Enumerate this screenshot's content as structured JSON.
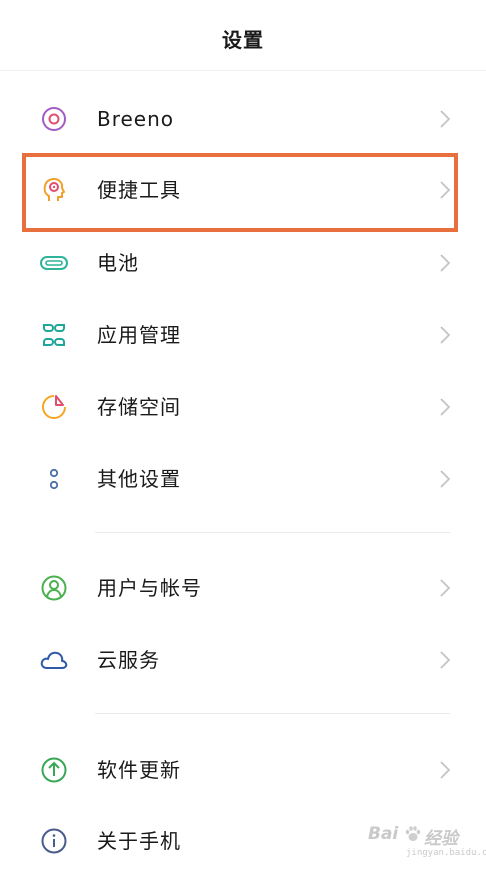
{
  "header": {
    "title": "设置"
  },
  "settings": {
    "items": [
      {
        "label": "Breeno",
        "icon": "breeno-icon",
        "color": "#a35bc4"
      },
      {
        "label": "便捷工具",
        "icon": "convenience-tools-icon",
        "color": "#f0a02b"
      },
      {
        "label": "电池",
        "icon": "battery-icon",
        "color": "#2fb49a"
      },
      {
        "label": "应用管理",
        "icon": "app-management-icon",
        "color": "#1fa69a"
      },
      {
        "label": "存储空间",
        "icon": "storage-icon",
        "color": "#f5a623"
      },
      {
        "label": "其他设置",
        "icon": "other-settings-icon",
        "color": "#4a6fa5"
      },
      {
        "label": "用户与帐号",
        "icon": "user-account-icon",
        "color": "#4caf50"
      },
      {
        "label": "云服务",
        "icon": "cloud-icon",
        "color": "#2f5aa8"
      },
      {
        "label": "软件更新",
        "icon": "software-update-icon",
        "color": "#3aa757"
      },
      {
        "label": "关于手机",
        "icon": "about-phone-icon",
        "color": "#4a5a8a"
      }
    ]
  },
  "annotation": {
    "highlight_color": "#e8703f",
    "highlighted_item": "便捷工具"
  },
  "watermark": {
    "main": "Bai",
    "main2": "经验",
    "sub": "jingyan.baidu.com"
  }
}
